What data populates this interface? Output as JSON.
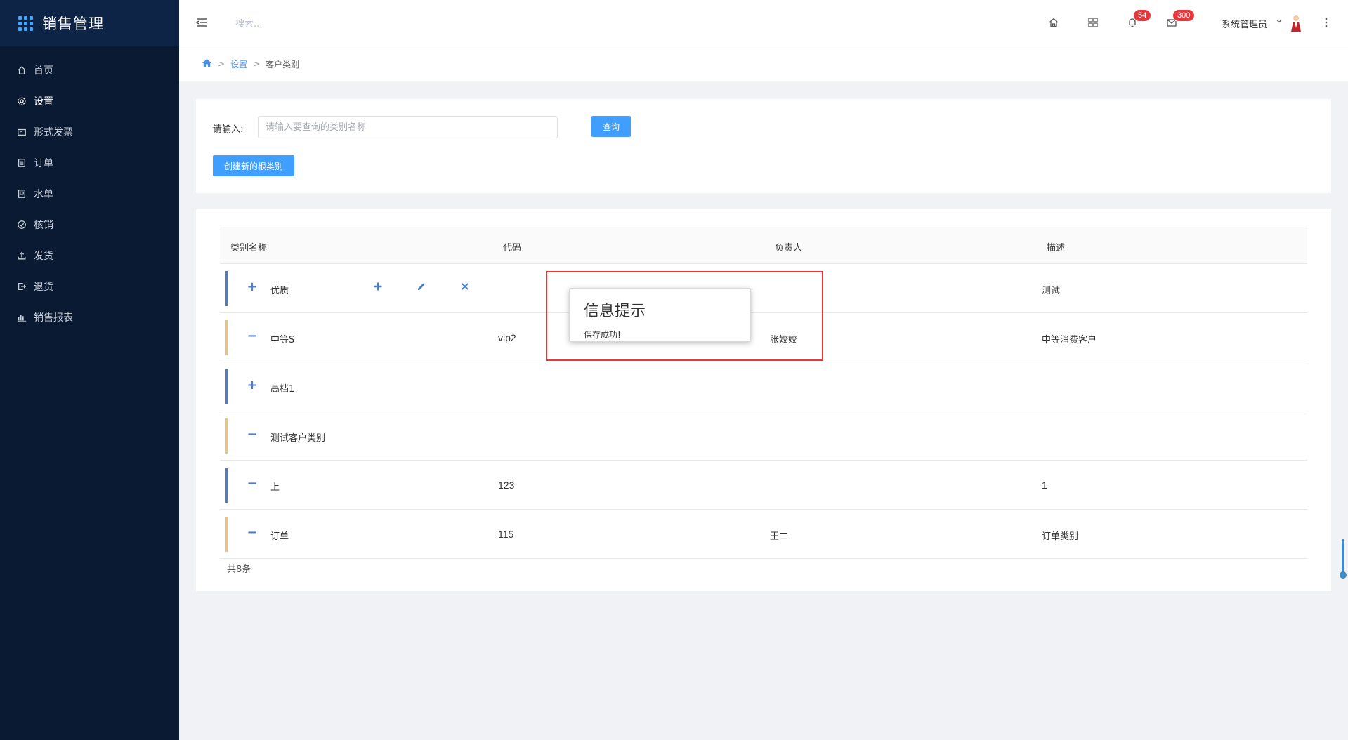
{
  "app": {
    "title": "销售管理"
  },
  "sidebar": {
    "items": [
      {
        "label": "首页",
        "icon": "home-icon"
      },
      {
        "label": "设置",
        "icon": "gear-icon",
        "active": true
      },
      {
        "label": "形式发票",
        "icon": "invoice-icon"
      },
      {
        "label": "订单",
        "icon": "order-icon"
      },
      {
        "label": "水单",
        "icon": "receipt-icon"
      },
      {
        "label": "核销",
        "icon": "check-circle-icon"
      },
      {
        "label": "发货",
        "icon": "upload-icon"
      },
      {
        "label": "退货",
        "icon": "return-icon"
      },
      {
        "label": "销售报表",
        "icon": "bar-chart-icon"
      }
    ]
  },
  "header": {
    "search_placeholder": "搜索...",
    "notifications_count": "54",
    "messages_count": "300",
    "user_name": "系统管理员"
  },
  "breadcrumb": {
    "parent": "设置",
    "current": "客户类别",
    "separator": ">"
  },
  "search": {
    "label": "请输入:",
    "placeholder": "请输入要查询的类别名称",
    "query_button": "查询",
    "create_button": "创建新的根类别"
  },
  "table": {
    "columns": [
      "类别名称",
      "代码",
      "负责人",
      "描述"
    ],
    "rows": [
      {
        "expand": "+",
        "name": "优质",
        "code": "",
        "owner": "",
        "desc": "测试",
        "bar": "blue",
        "actions": true
      },
      {
        "expand": "−",
        "name": "中等S",
        "code": "vip2",
        "owner": "张姣姣",
        "desc": "中等消费客户",
        "bar": "yellow"
      },
      {
        "expand": "+",
        "name": "高档1",
        "code": "",
        "owner": "",
        "desc": "",
        "bar": "blue"
      },
      {
        "expand": "−",
        "name": "测试客户类别",
        "code": "",
        "owner": "",
        "desc": "",
        "bar": "yellow"
      },
      {
        "expand": "−",
        "name": "上",
        "code": "123",
        "owner": "",
        "desc": "1",
        "bar": "blue"
      },
      {
        "expand": "−",
        "name": "订单",
        "code": "115",
        "owner": "王二",
        "desc": "订单类别",
        "bar": "yellow"
      }
    ],
    "total": "共8条"
  },
  "toast": {
    "title": "信息提示",
    "message": "保存成功!"
  },
  "colors": {
    "sidebar": "#0a1a33",
    "accent": "#409eff",
    "highlight": "#e53935",
    "badge": "#e4393c"
  }
}
